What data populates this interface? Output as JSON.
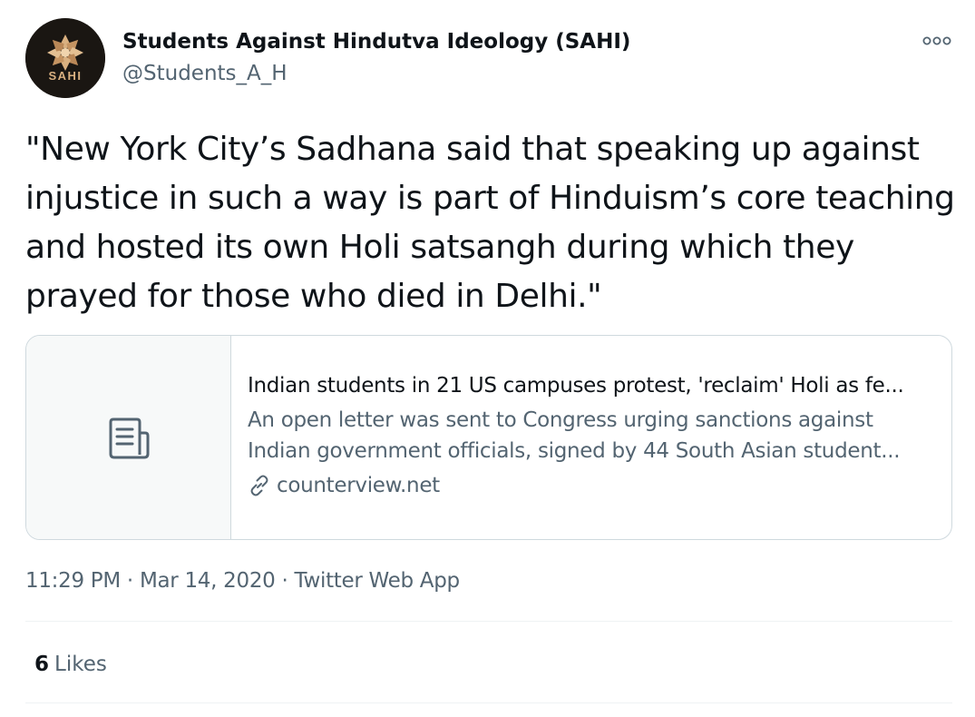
{
  "author": {
    "display_name": "Students Against Hindutva Ideology (SAHI)",
    "handle": "@Students_A_H",
    "avatar_text": "SAHI"
  },
  "tweet": {
    "text": "\"New York City’s Sadhana said that speaking up against injustice in such a way is part of Hinduism’s core teaching and hosted its own Holi satsangh during which they prayed for those who died in Delhi.\""
  },
  "card": {
    "title": "Indian students in 21 US campuses protest, 'reclaim' Holi as fe...",
    "description_line1": "An open letter was sent to Congress urging sanctions against",
    "description_line2": "Indian government officials, signed by 44 South Asian student...",
    "domain": "counterview.net",
    "media_icon": "document-icon",
    "domain_icon": "link-icon"
  },
  "meta": {
    "time": "11:29 PM",
    "separator1": " · ",
    "date": "Mar 14, 2020",
    "separator2": " · ",
    "source": "Twitter Web App"
  },
  "stats": {
    "likes_count": "6",
    "likes_label": "Likes"
  },
  "icons": {
    "more": "more-horizontal-icon"
  },
  "colors": {
    "text_primary": "#0f1419",
    "text_secondary": "#536471",
    "border": "#cfd9de",
    "card_media_bg": "#f7f9f9",
    "avatar_bg": "#1a1612",
    "avatar_accent": "#c9a06b"
  }
}
